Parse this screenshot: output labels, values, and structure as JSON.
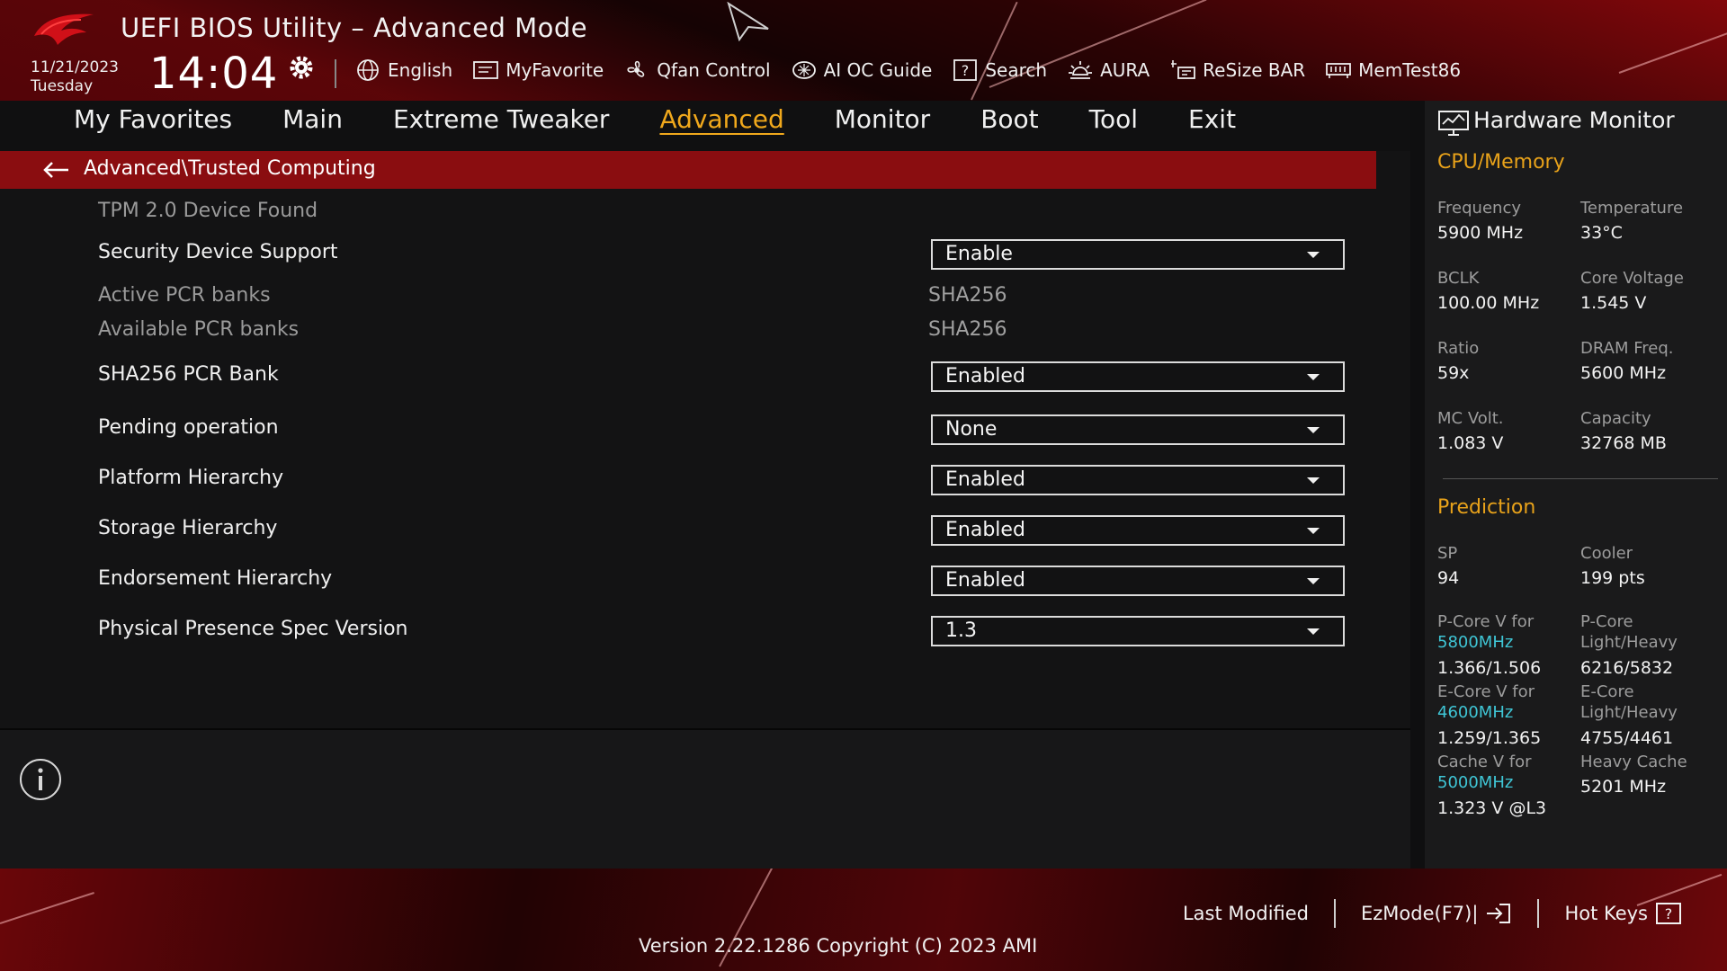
{
  "header": {
    "title": "UEFI BIOS Utility – Advanced Mode",
    "date": "11/21/2023",
    "day": "Tuesday",
    "time": "14:04",
    "toolbar": [
      {
        "label": "English",
        "icon": "globe-icon"
      },
      {
        "label": "MyFavorite",
        "icon": "favorite-icon"
      },
      {
        "label": "Qfan Control",
        "icon": "fan-icon"
      },
      {
        "label": "AI OC Guide",
        "icon": "ai-oc-icon"
      },
      {
        "label": "Search",
        "icon": "search-help-icon"
      },
      {
        "label": "AURA",
        "icon": "aura-icon"
      },
      {
        "label": "ReSize BAR",
        "icon": "resize-bar-icon"
      },
      {
        "label": "MemTest86",
        "icon": "memtest-icon"
      }
    ]
  },
  "nav": {
    "tabs": [
      "My Favorites",
      "Main",
      "Extreme Tweaker",
      "Advanced",
      "Monitor",
      "Boot",
      "Tool",
      "Exit"
    ],
    "active": "Advanced"
  },
  "breadcrumb": "Advanced\\Trusted Computing",
  "settings": {
    "tpm_found": "TPM 2.0 Device Found",
    "security_device_support": {
      "label": "Security Device Support",
      "value": "Enable"
    },
    "active_pcr_banks": {
      "label": "Active PCR banks",
      "value": "SHA256"
    },
    "available_pcr_banks": {
      "label": "Available PCR banks",
      "value": "SHA256"
    },
    "sha256_pcr_bank": {
      "label": "SHA256 PCR Bank",
      "value": "Enabled"
    },
    "pending_operation": {
      "label": "Pending operation",
      "value": "None"
    },
    "platform_hierarchy": {
      "label": "Platform Hierarchy",
      "value": "Enabled"
    },
    "storage_hierarchy": {
      "label": "Storage Hierarchy",
      "value": "Enabled"
    },
    "endorsement_hierarchy": {
      "label": "Endorsement Hierarchy",
      "value": "Enabled"
    },
    "physical_presence_spec": {
      "label": "Physical Presence Spec Version",
      "value": "1.3"
    }
  },
  "hw_monitor": {
    "title": "Hardware Monitor",
    "cpu_memory": {
      "heading": "CPU/Memory",
      "frequency": {
        "label": "Frequency",
        "value": "5900 MHz"
      },
      "temperature": {
        "label": "Temperature",
        "value": "33°C"
      },
      "bclk": {
        "label": "BCLK",
        "value": "100.00 MHz"
      },
      "core_voltage": {
        "label": "Core Voltage",
        "value": "1.545 V"
      },
      "ratio": {
        "label": "Ratio",
        "value": "59x"
      },
      "dram_freq": {
        "label": "DRAM Freq.",
        "value": "5600 MHz"
      },
      "mc_volt": {
        "label": "MC Volt.",
        "value": "1.083 V"
      },
      "capacity": {
        "label": "Capacity",
        "value": "32768 MB"
      }
    },
    "prediction": {
      "heading": "Prediction",
      "sp": {
        "label": "SP",
        "value": "94"
      },
      "cooler": {
        "label": "Cooler",
        "value": "199 pts"
      },
      "pcore_v": {
        "label": "P-Core V for",
        "freq": "5800MHz",
        "value": "1.366/1.506"
      },
      "pcore_lh": {
        "label1": "P-Core",
        "label2": "Light/Heavy",
        "value": "6216/5832"
      },
      "ecore_v": {
        "label": "E-Core V for",
        "freq": "4600MHz",
        "value": "1.259/1.365"
      },
      "ecore_lh": {
        "label1": "E-Core",
        "label2": "Light/Heavy",
        "value": "4755/4461"
      },
      "cache_v": {
        "label": "Cache V for",
        "freq": "5000MHz",
        "value": "1.323 V @L3"
      },
      "heavy_cache": {
        "label": "Heavy Cache",
        "value": "5201 MHz"
      }
    }
  },
  "footer": {
    "last_modified": "Last Modified",
    "ezmode": "EzMode(F7)|",
    "hot_keys": "Hot Keys",
    "version": "Version 2.22.1286 Copyright (C) 2023 AMI"
  },
  "colors": {
    "accent": "#f0a81c",
    "breadcrumb_bg": "#8a0d10",
    "freq_cyan": "#3fc6d6"
  }
}
